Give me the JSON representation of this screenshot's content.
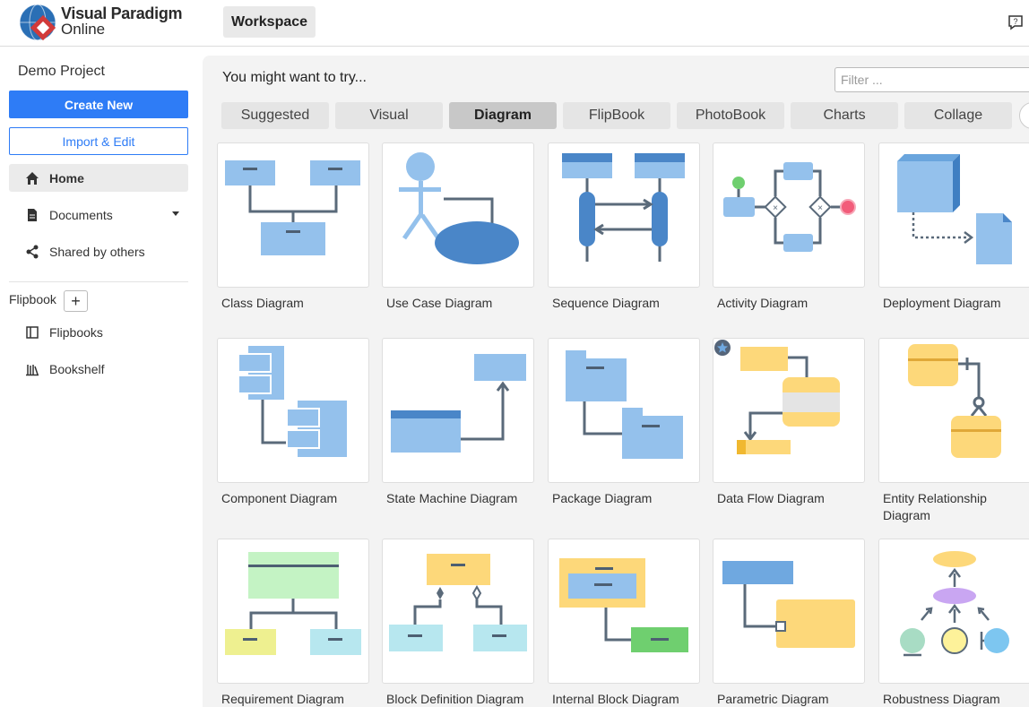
{
  "header": {
    "brand_line1": "Visual Paradigm",
    "brand_line2": "Online",
    "workspace_label": "Workspace",
    "help_icon": "help-chat-icon"
  },
  "sidebar": {
    "project_name": "Demo Project",
    "create_new": "Create New",
    "import_edit": "Import & Edit",
    "nav": [
      {
        "label": "Home",
        "icon": "home-icon",
        "active": true
      },
      {
        "label": "Documents",
        "icon": "document-icon",
        "active": false
      },
      {
        "label": "Shared by others",
        "icon": "share-icon",
        "active": false
      }
    ],
    "flipbook_label": "Flipbook",
    "flipbook_add": "+",
    "flipbook_items": [
      {
        "label": "Flipbooks",
        "icon": "flipbook-icon"
      },
      {
        "label": "Bookshelf",
        "icon": "bookshelf-icon"
      }
    ]
  },
  "main": {
    "heading": "You might want to try...",
    "filter_placeholder": "Filter ...",
    "tabs": [
      {
        "label": "Suggested",
        "active": false
      },
      {
        "label": "Visual",
        "active": false
      },
      {
        "label": "Diagram",
        "active": true
      },
      {
        "label": "FlipBook",
        "active": false
      },
      {
        "label": "PhotoBook",
        "active": false
      },
      {
        "label": "Charts",
        "active": false
      },
      {
        "label": "Collage",
        "active": false
      }
    ],
    "cards": [
      {
        "label": "Class Diagram"
      },
      {
        "label": "Use Case Diagram"
      },
      {
        "label": "Sequence Diagram"
      },
      {
        "label": "Activity Diagram"
      },
      {
        "label": "Deployment Diagram"
      },
      {
        "label": "Component Diagram"
      },
      {
        "label": "State Machine Diagram"
      },
      {
        "label": "Package Diagram"
      },
      {
        "label": "Data Flow Diagram"
      },
      {
        "label": "Entity Relationship Diagram"
      },
      {
        "label": "Requirement Diagram"
      },
      {
        "label": "Block Definition Diagram"
      },
      {
        "label": "Internal Block Diagram"
      },
      {
        "label": "Parametric Diagram"
      },
      {
        "label": "Robustness Diagram"
      }
    ]
  },
  "colors": {
    "accent": "#2e7cf6",
    "diagram_blue": "#94c1ec",
    "diagram_dark_blue": "#4a86c8",
    "connector": "#5a6a7a",
    "yellow": "#fdd87a",
    "green": "#7ed07e"
  }
}
